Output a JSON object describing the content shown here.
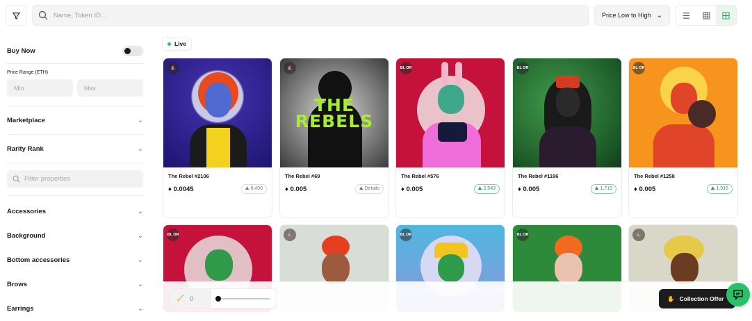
{
  "search": {
    "placeholder": "Name, Token ID..."
  },
  "sort": {
    "label": "Price Low to High"
  },
  "sidebar": {
    "buy_now": "Buy Now",
    "price_range": "Price Range (ETH)",
    "min": "Min",
    "max": "Max",
    "marketplace": "Marketplace",
    "rarity": "Rarity Rank",
    "filter_props": "Filter properties",
    "props": [
      "Accessories",
      "Background",
      "Bottom accessories",
      "Brows",
      "Earrings"
    ]
  },
  "live": "Live",
  "cards": [
    {
      "name": "The Rebel #2106",
      "price": "0.0045",
      "chip": "8,490",
      "chip_green": false
    },
    {
      "name": "The Rebel #69",
      "price": "0.005",
      "chip": "Details",
      "chip_green": false
    },
    {
      "name": "The Rebel #576",
      "price": "0.005",
      "chip": "2,543",
      "chip_green": true
    },
    {
      "name": "The Rebel #1196",
      "price": "0.005",
      "chip": "1,713",
      "chip_green": true
    },
    {
      "name": "The Rebel #1258",
      "price": "0.005",
      "chip": "1,916",
      "chip_green": true
    }
  ],
  "art_rebels_text": "THE REBELS",
  "badge_text": "BL OR",
  "eth_symbol": "♦",
  "sweep": {
    "count": "0"
  },
  "collection_offer": "Collection Offer",
  "colors": {
    "accent": "#27c16a",
    "dark": "#1c1c1c"
  }
}
